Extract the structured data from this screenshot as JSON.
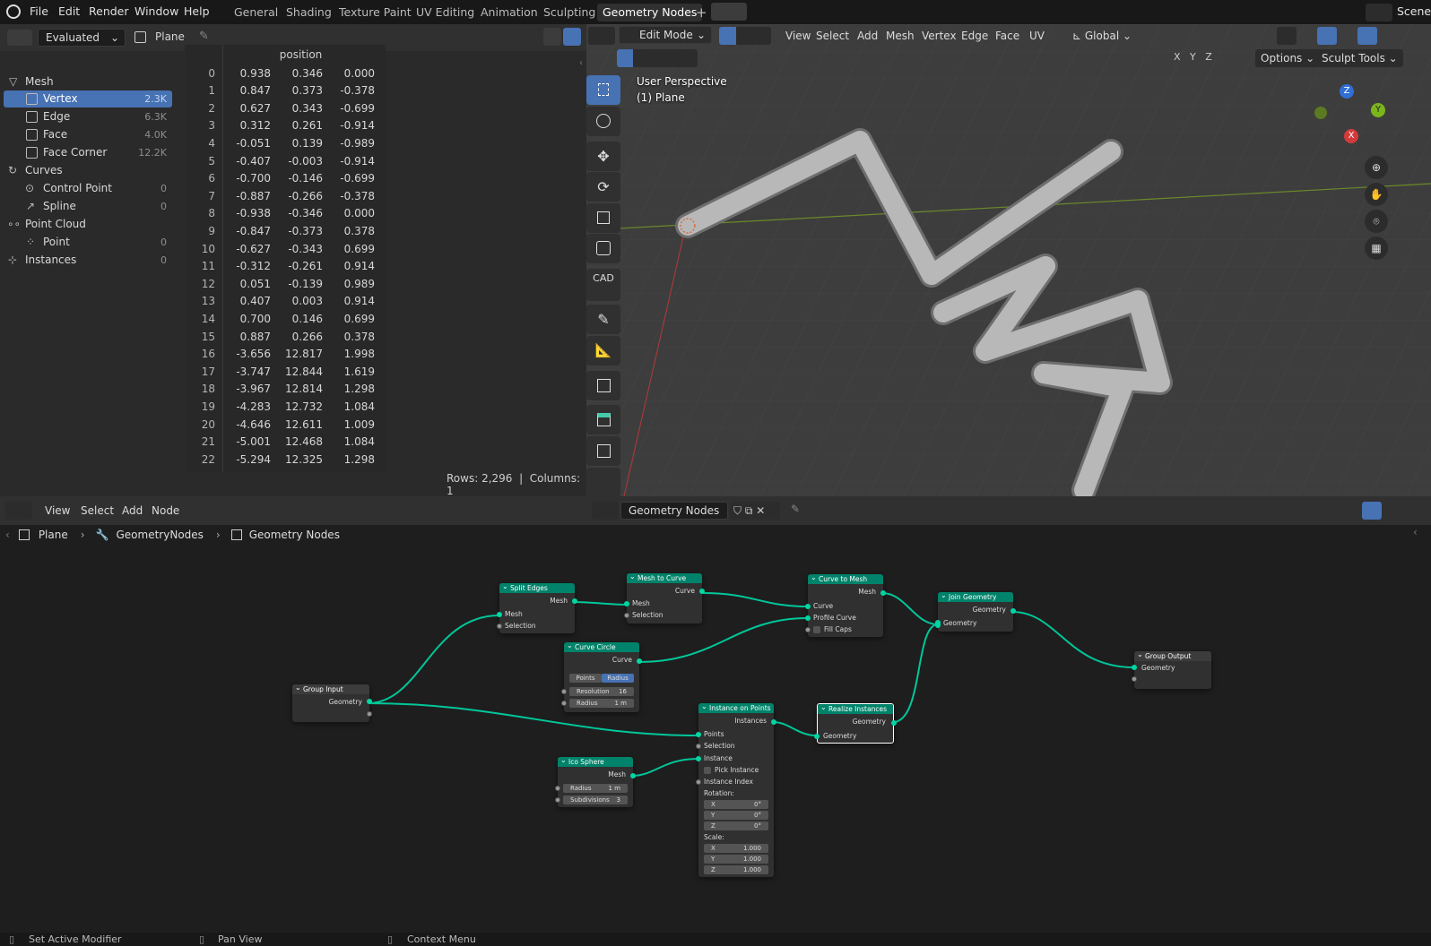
{
  "topbar": {
    "menus": [
      "File",
      "Edit",
      "Render",
      "Window",
      "Help"
    ],
    "workspaces": [
      "General",
      "Shading",
      "Texture Paint",
      "UV Editing",
      "Animation",
      "Sculpting",
      "Geometry Nodes"
    ],
    "active_workspace": "Geometry Nodes",
    "add_tab": "+",
    "scene_label": "Scene"
  },
  "spreadsheet": {
    "evaluated_label": "Evaluated",
    "object_label": "Plane",
    "column_header": "position",
    "tree": [
      {
        "label": "Mesh",
        "count": ""
      },
      {
        "label": "Vertex",
        "count": "2.3K"
      },
      {
        "label": "Edge",
        "count": "6.3K"
      },
      {
        "label": "Face",
        "count": "4.0K"
      },
      {
        "label": "Face Corner",
        "count": "12.2K"
      },
      {
        "label": "Curves",
        "count": ""
      },
      {
        "label": "Control Point",
        "count": "0"
      },
      {
        "label": "Spline",
        "count": "0"
      },
      {
        "label": "Point Cloud",
        "count": ""
      },
      {
        "label": "Point",
        "count": "0"
      },
      {
        "label": "Instances",
        "count": "0"
      }
    ],
    "rows": [
      [
        "0",
        "0.938",
        "0.346",
        "0.000"
      ],
      [
        "1",
        "0.847",
        "0.373",
        "-0.378"
      ],
      [
        "2",
        "0.627",
        "0.343",
        "-0.699"
      ],
      [
        "3",
        "0.312",
        "0.261",
        "-0.914"
      ],
      [
        "4",
        "-0.051",
        "0.139",
        "-0.989"
      ],
      [
        "5",
        "-0.407",
        "-0.003",
        "-0.914"
      ],
      [
        "6",
        "-0.700",
        "-0.146",
        "-0.699"
      ],
      [
        "7",
        "-0.887",
        "-0.266",
        "-0.378"
      ],
      [
        "8",
        "-0.938",
        "-0.346",
        "0.000"
      ],
      [
        "9",
        "-0.847",
        "-0.373",
        "0.378"
      ],
      [
        "10",
        "-0.627",
        "-0.343",
        "0.699"
      ],
      [
        "11",
        "-0.312",
        "-0.261",
        "0.914"
      ],
      [
        "12",
        "0.051",
        "-0.139",
        "0.989"
      ],
      [
        "13",
        "0.407",
        "0.003",
        "0.914"
      ],
      [
        "14",
        "0.700",
        "0.146",
        "0.699"
      ],
      [
        "15",
        "0.887",
        "0.266",
        "0.378"
      ],
      [
        "16",
        "-3.656",
        "12.817",
        "1.998"
      ],
      [
        "17",
        "-3.747",
        "12.844",
        "1.619"
      ],
      [
        "18",
        "-3.967",
        "12.814",
        "1.298"
      ],
      [
        "19",
        "-4.283",
        "12.732",
        "1.084"
      ],
      [
        "20",
        "-4.646",
        "12.611",
        "1.009"
      ],
      [
        "21",
        "-5.001",
        "12.468",
        "1.084"
      ],
      [
        "22",
        "-5.294",
        "12.325",
        "1.298"
      ]
    ],
    "rows_info": "Rows: 2,296",
    "separator": "|",
    "columns_info": "Columns: 1"
  },
  "viewport": {
    "mode_label": "Edit Mode",
    "menus": [
      "View",
      "Select",
      "Add",
      "Mesh",
      "Vertex",
      "Edge",
      "Face",
      "UV"
    ],
    "orientation_label": "Global",
    "options_label": "Options",
    "sculpt_tools_label": "Sculpt Tools",
    "axes": [
      "X",
      "Y",
      "Z"
    ],
    "overlay_line1": "User Perspective",
    "overlay_line2": "(1) Plane",
    "cad_label": "CAD",
    "gizmo": {
      "z": "Z",
      "y": "Y",
      "x": "X"
    }
  },
  "node_editor": {
    "menus": [
      "View",
      "Select",
      "Add",
      "Node"
    ],
    "tree_name": "Geometry Nodes",
    "breadcrumb": [
      "Plane",
      "GeometryNodes",
      "Geometry Nodes"
    ],
    "nodes": {
      "group_input": {
        "title": "Group Input",
        "out": "Geometry"
      },
      "split_edges": {
        "title": "Split Edges",
        "out": "Mesh",
        "in1": "Mesh",
        "in2": "Selection"
      },
      "mesh_to_curve": {
        "title": "Mesh to Curve",
        "out": "Curve",
        "in1": "Mesh",
        "in2": "Selection"
      },
      "curve_circle": {
        "title": "Curve Circle",
        "out": "Curve",
        "mode1": "Points",
        "mode2": "Radius",
        "res_label": "Resolution",
        "res_value": "16",
        "rad_label": "Radius",
        "rad_value": "1 m"
      },
      "curve_to_mesh": {
        "title": "Curve to Mesh",
        "out": "Mesh",
        "in1": "Curve",
        "in2": "Profile Curve",
        "in3": "Fill Caps"
      },
      "join_geometry": {
        "title": "Join Geometry",
        "out": "Geometry",
        "in1": "Geometry"
      },
      "group_output": {
        "title": "Group Output",
        "in1": "Geometry"
      },
      "instance_on_points": {
        "title": "Instance on Points",
        "out": "Instances",
        "in1": "Points",
        "in2": "Selection",
        "in3": "Instance",
        "in4": "Pick Instance",
        "in5": "Instance Index",
        "rot_label": "Rotation:",
        "rx": "0°",
        "ry": "0°",
        "rz": "0°",
        "scale_label": "Scale:",
        "sx": "1.000",
        "sy": "1.000",
        "sz": "1.000"
      },
      "realize_instances": {
        "title": "Realize Instances",
        "out": "Geometry",
        "in1": "Geometry"
      },
      "ico_sphere": {
        "title": "Ico Sphere",
        "out": "Mesh",
        "rad_label": "Radius",
        "rad_value": "1 m",
        "sub_label": "Subdivisions",
        "sub_value": "3"
      }
    }
  },
  "statusbar": {
    "items": [
      "Set Active Modifier",
      "Pan View",
      "Context Menu"
    ]
  },
  "colors": {
    "accent": "#4772b3",
    "node_header": "#00836a",
    "link": "#00d6a3"
  }
}
